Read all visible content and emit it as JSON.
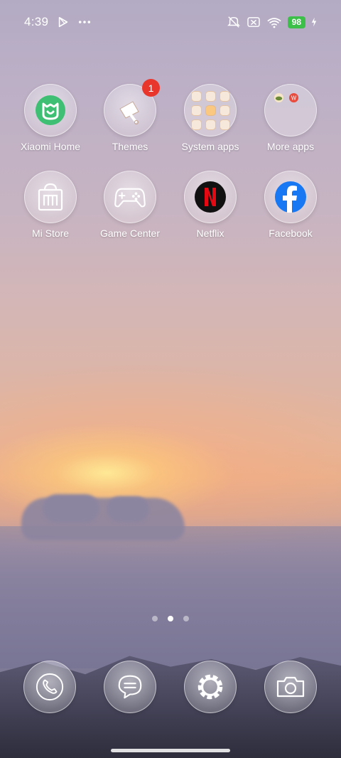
{
  "status_bar": {
    "time": "4:39",
    "battery": "98",
    "icons": [
      "play-store-icon",
      "more-dots-icon",
      "mute-icon",
      "no-sim-icon",
      "wifi-icon",
      "charging-icon"
    ]
  },
  "apps": [
    {
      "label": "Xiaomi Home",
      "icon": "xiaomi-home-icon"
    },
    {
      "label": "Themes",
      "icon": "themes-icon",
      "badge": "1"
    },
    {
      "label": "System apps",
      "icon": "folder-icon"
    },
    {
      "label": "More apps",
      "icon": "folder-icon"
    },
    {
      "label": "Mi Store",
      "icon": "mi-store-icon"
    },
    {
      "label": "Game Center",
      "icon": "gamepad-icon"
    },
    {
      "label": "Netflix",
      "icon": "netflix-icon"
    },
    {
      "label": "Facebook",
      "icon": "facebook-icon"
    }
  ],
  "pager": {
    "count": 3,
    "active": 2
  },
  "dock": [
    {
      "icon": "phone-icon"
    },
    {
      "icon": "messages-icon"
    },
    {
      "icon": "settings-icon"
    },
    {
      "icon": "camera-icon"
    }
  ],
  "colors": {
    "battery": "#3cc04a",
    "badge": "#e8362d",
    "netflix_red": "#e50914",
    "facebook_blue": "#1877f2",
    "xiaomi_green": "#3fbf73"
  }
}
